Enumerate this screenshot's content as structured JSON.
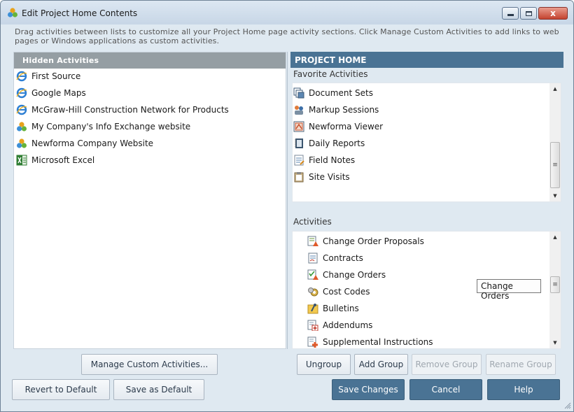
{
  "window": {
    "title": "Edit Project Home Contents",
    "close_glyph": "x",
    "instructions": "Drag activities between lists to customize all your Project Home page activity sections.  Click Manage Custom Activities to add links to web pages or Windows applications as custom activities."
  },
  "hidden_activities": {
    "header": "Hidden Activities",
    "items": [
      {
        "label": "First Source",
        "icon": "internet-explorer-icon"
      },
      {
        "label": "Google Maps",
        "icon": "internet-explorer-icon"
      },
      {
        "label": "McGraw-Hill Construction Network for Products",
        "icon": "internet-explorer-icon"
      },
      {
        "label": "My Company's Info Exchange website",
        "icon": "newforma-icon"
      },
      {
        "label": "Newforma Company Website",
        "icon": "newforma-icon"
      },
      {
        "label": "Microsoft Excel",
        "icon": "excel-icon"
      }
    ]
  },
  "project_home": {
    "header": "PROJECT HOME",
    "favorites_label": "Favorite Activities",
    "favorites": [
      {
        "label": "Document Sets",
        "icon": "document-sets-icon"
      },
      {
        "label": "Markup Sessions",
        "icon": "markup-sessions-icon"
      },
      {
        "label": "Newforma Viewer",
        "icon": "viewer-icon"
      },
      {
        "label": "Daily Reports",
        "icon": "daily-reports-icon"
      },
      {
        "label": "Field Notes",
        "icon": "field-notes-icon"
      },
      {
        "label": "Site Visits",
        "icon": "site-visits-icon"
      }
    ],
    "activities_label": "Activities",
    "activities": [
      {
        "label": "Change Order Proposals",
        "icon": "change-order-proposals-icon"
      },
      {
        "label": "Contracts",
        "icon": "contracts-icon"
      },
      {
        "label": "Change Orders",
        "icon": "change-orders-icon"
      },
      {
        "label": "Cost Codes",
        "icon": "cost-codes-icon"
      },
      {
        "label": "Bulletins",
        "icon": "bulletins-icon"
      },
      {
        "label": "Addendums",
        "icon": "addendums-icon"
      },
      {
        "label": "Supplemental Instructions",
        "icon": "supplemental-instructions-icon"
      }
    ],
    "tooltip": "Change Orders"
  },
  "buttons": {
    "manage_custom": "Manage Custom Activities...",
    "ungroup": "Ungroup",
    "add_group": "Add Group",
    "remove_group": "Remove Group",
    "rename_group": "Rename Group",
    "revert_default": "Revert to Default",
    "save_default": "Save as Default",
    "save_changes": "Save Changes",
    "cancel": "Cancel",
    "help": "Help"
  },
  "colors": {
    "accent": "#4a7394",
    "hidden_header": "#959ea3",
    "window_bg": "#dfe9f1"
  }
}
